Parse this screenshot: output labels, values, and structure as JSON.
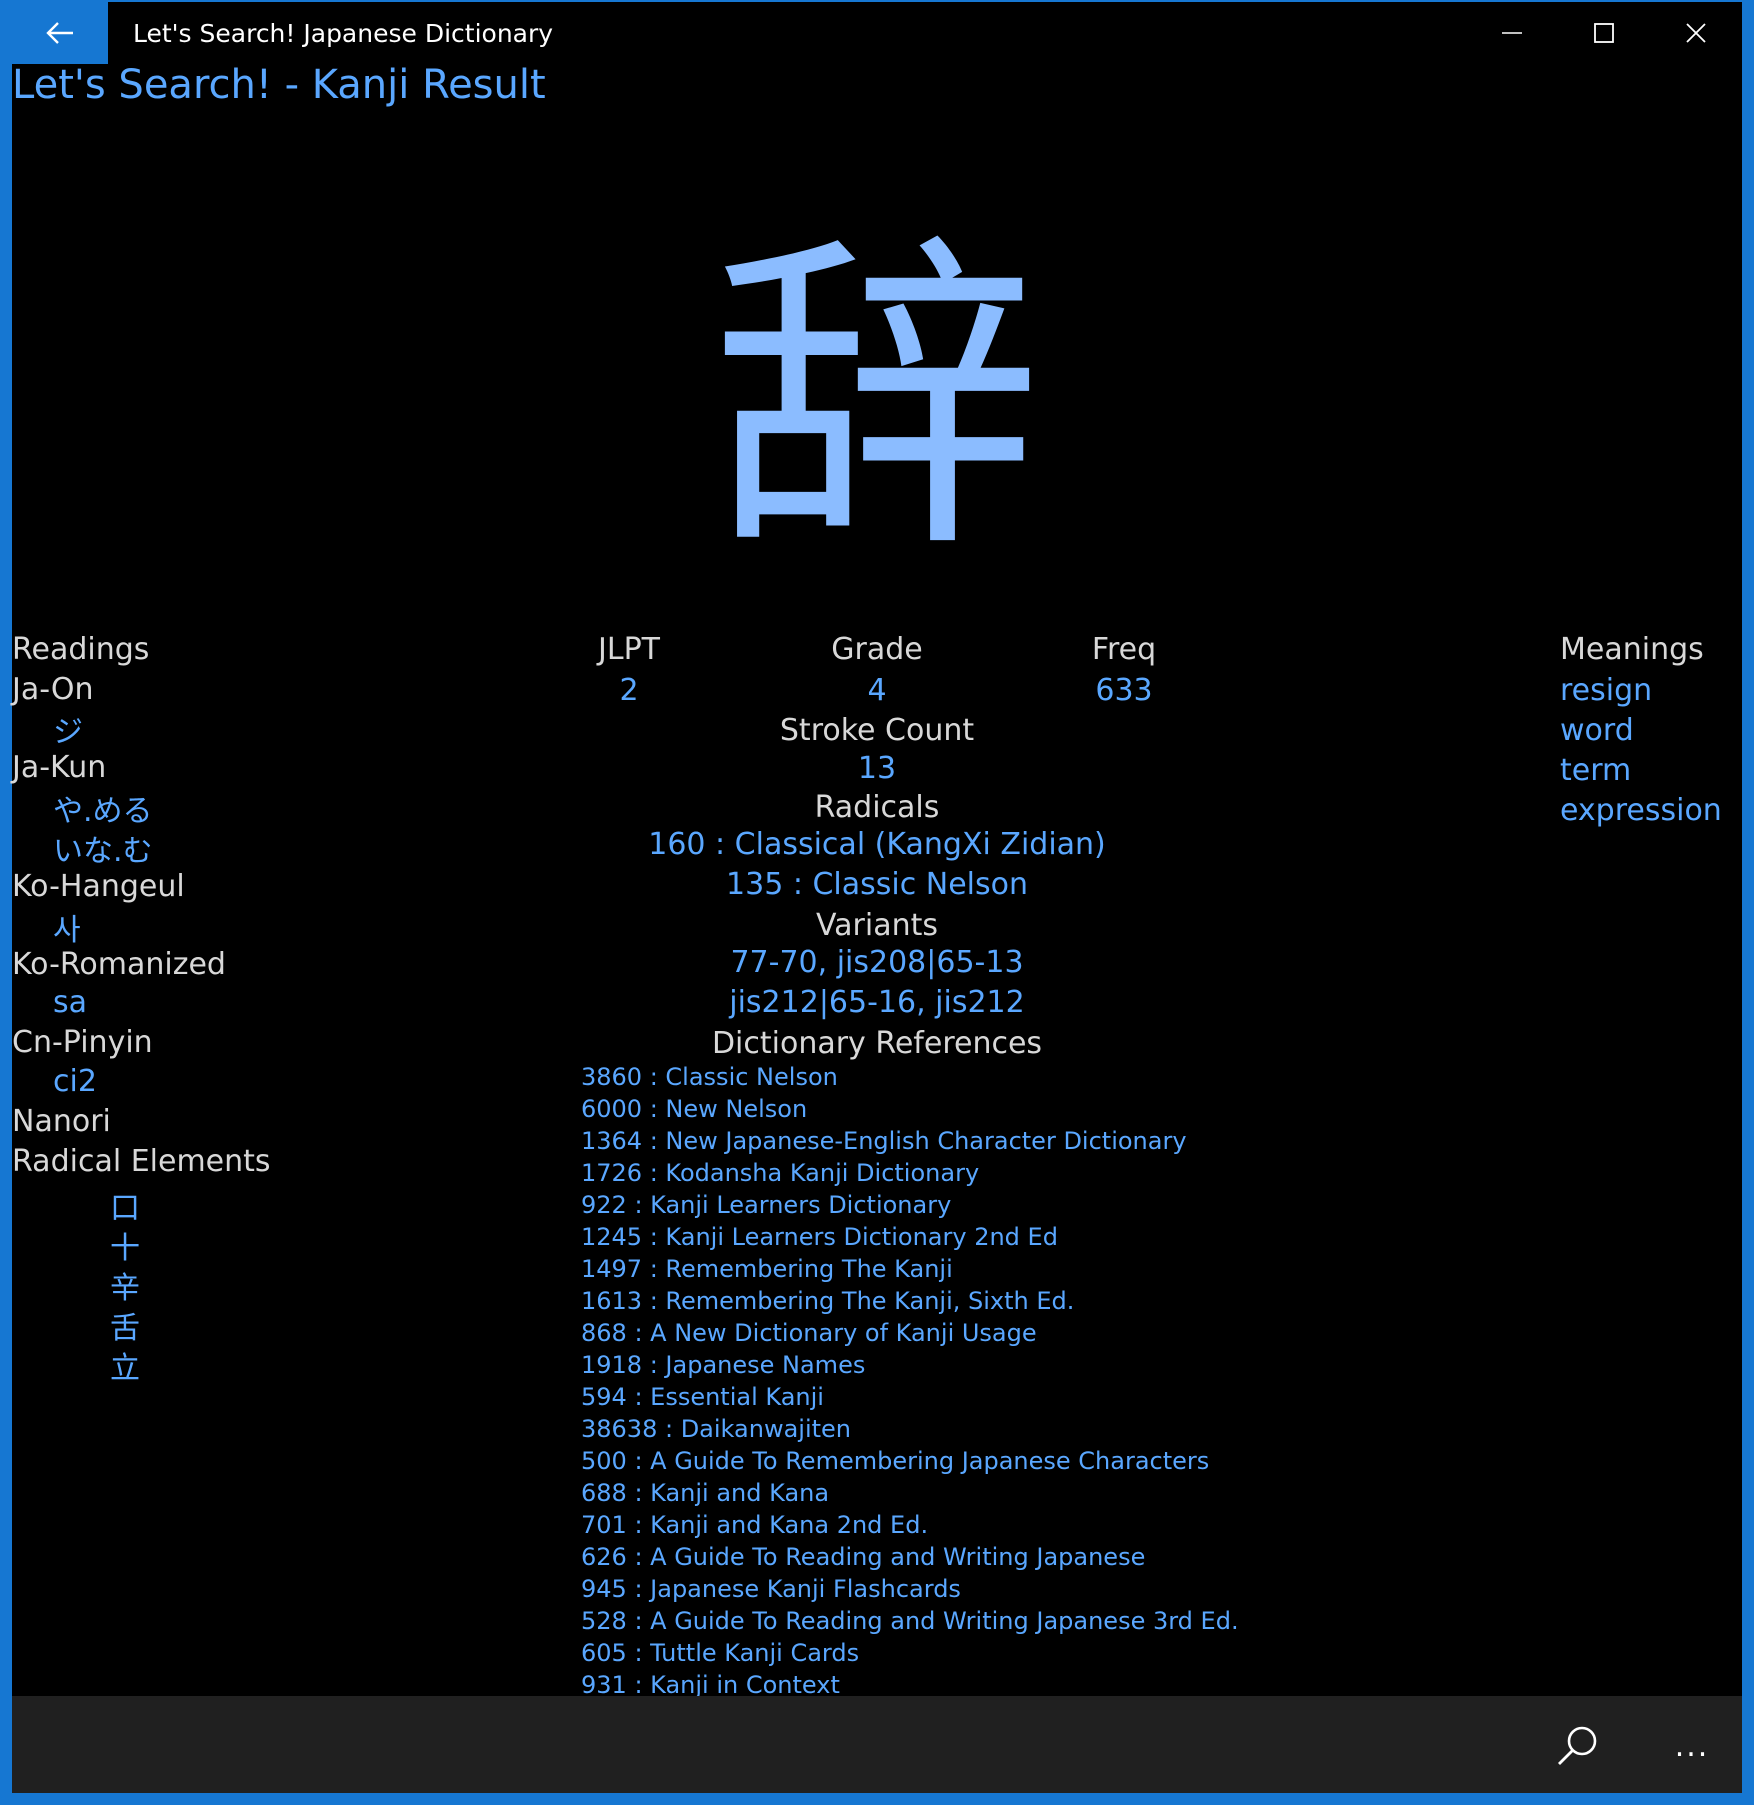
{
  "window": {
    "app_title": "Let's Search! Japanese Dictionary"
  },
  "page": {
    "heading": "Let's Search! - Kanji Result",
    "kanji": "辞"
  },
  "readings": {
    "header": "Readings",
    "ja_on_label": "Ja-On",
    "ja_on": [
      "ジ"
    ],
    "ja_kun_label": "Ja-Kun",
    "ja_kun": [
      "や.める",
      "いな.む"
    ],
    "ko_hangeul_label": "Ko-Hangeul",
    "ko_hangeul": [
      "사"
    ],
    "ko_romanized_label": "Ko-Romanized",
    "ko_romanized": [
      "sa"
    ],
    "cn_pinyin_label": "Cn-Pinyin",
    "cn_pinyin": [
      "ci2"
    ],
    "nanori_label": "Nanori",
    "radical_elements_label": "Radical Elements",
    "radical_elements": [
      "口",
      "十",
      "辛",
      "舌",
      "立"
    ]
  },
  "info": {
    "jlpt_label": "JLPT",
    "jlpt": "2",
    "grade_label": "Grade",
    "grade": "4",
    "freq_label": "Freq",
    "freq": "633",
    "stroke_count_label": "Stroke Count",
    "stroke_count": "13",
    "radicals_label": "Radicals",
    "radicals": [
      "160  :  Classical (KangXi Zidian)",
      "135  :  Classic Nelson"
    ],
    "variants_label": "Variants",
    "variants": [
      "77-70, jis208|65-13",
      "jis212|65-16, jis212"
    ],
    "dict_refs_label": "Dictionary References",
    "dict_refs": [
      "3860  :  Classic Nelson",
      "6000  :  New Nelson",
      "1364  :  New Japanese-English Character Dictionary",
      "1726  :  Kodansha Kanji Dictionary",
      "922  :  Kanji Learners Dictionary",
      "1245  :  Kanji Learners Dictionary 2nd Ed",
      "1497  :  Remembering The  Kanji",
      "1613  :  Remembering The  Kanji, Sixth Ed.",
      "868  :  A  New Dictionary of Kanji Usage",
      "1918  :  Japanese Names",
      "594  :  Essential Kanji",
      "38638  :  Daikanwajiten",
      "500  :  A Guide To Remembering Japanese Characters",
      "688  :  Kanji and Kana",
      "701  :  Kanji and Kana 2nd Ed.",
      "626  :  A Guide To Reading and Writing Japanese",
      "945  :  Japanese Kanji Flashcards",
      "528  :  A Guide To Reading and Writing Japanese 3rd Ed.",
      "605  :  Tuttle Kanji Cards",
      "931  :  Kanji in Context"
    ]
  },
  "meanings": {
    "header": "Meanings",
    "items": [
      "resign",
      "word",
      "term",
      "expression"
    ]
  },
  "appbar": {
    "more_label": "..."
  }
}
